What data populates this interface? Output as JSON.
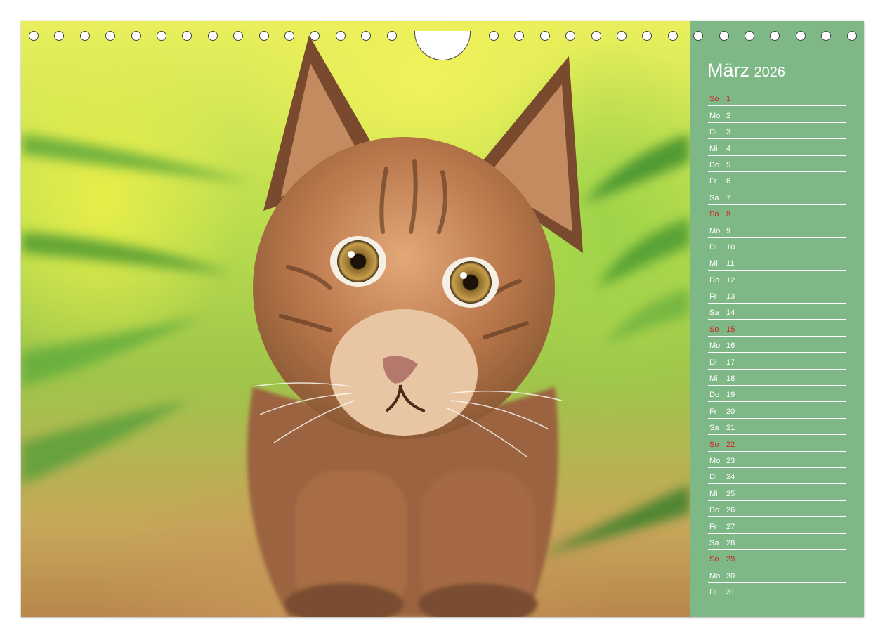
{
  "calendar": {
    "month": "März",
    "year": "2026",
    "sunday_color": "#cc2222",
    "panel_color": "#7fb887",
    "days": [
      {
        "name": "So",
        "num": "1",
        "sunday": true
      },
      {
        "name": "Mo",
        "num": "2"
      },
      {
        "name": "Di",
        "num": "3"
      },
      {
        "name": "Mi",
        "num": "4"
      },
      {
        "name": "Do",
        "num": "5"
      },
      {
        "name": "Fr",
        "num": "6"
      },
      {
        "name": "Sa",
        "num": "7"
      },
      {
        "name": "So",
        "num": "8",
        "sunday": true
      },
      {
        "name": "Mo",
        "num": "9"
      },
      {
        "name": "Di",
        "num": "10"
      },
      {
        "name": "Mi",
        "num": "11"
      },
      {
        "name": "Do",
        "num": "12"
      },
      {
        "name": "Fr",
        "num": "13"
      },
      {
        "name": "Sa",
        "num": "14"
      },
      {
        "name": "So",
        "num": "15",
        "sunday": true
      },
      {
        "name": "Mo",
        "num": "16"
      },
      {
        "name": "Di",
        "num": "17"
      },
      {
        "name": "Mi",
        "num": "18"
      },
      {
        "name": "Do",
        "num": "19"
      },
      {
        "name": "Fr",
        "num": "20"
      },
      {
        "name": "Sa",
        "num": "21"
      },
      {
        "name": "So",
        "num": "22",
        "sunday": true
      },
      {
        "name": "Mo",
        "num": "23"
      },
      {
        "name": "Di",
        "num": "24"
      },
      {
        "name": "Mi",
        "num": "25"
      },
      {
        "name": "Do",
        "num": "26"
      },
      {
        "name": "Fr",
        "num": "27"
      },
      {
        "name": "Sa",
        "num": "28"
      },
      {
        "name": "So",
        "num": "29",
        "sunday": true
      },
      {
        "name": "Mo",
        "num": "30"
      },
      {
        "name": "Di",
        "num": "31"
      }
    ]
  },
  "photo": {
    "subject": "lynx-kitten"
  }
}
